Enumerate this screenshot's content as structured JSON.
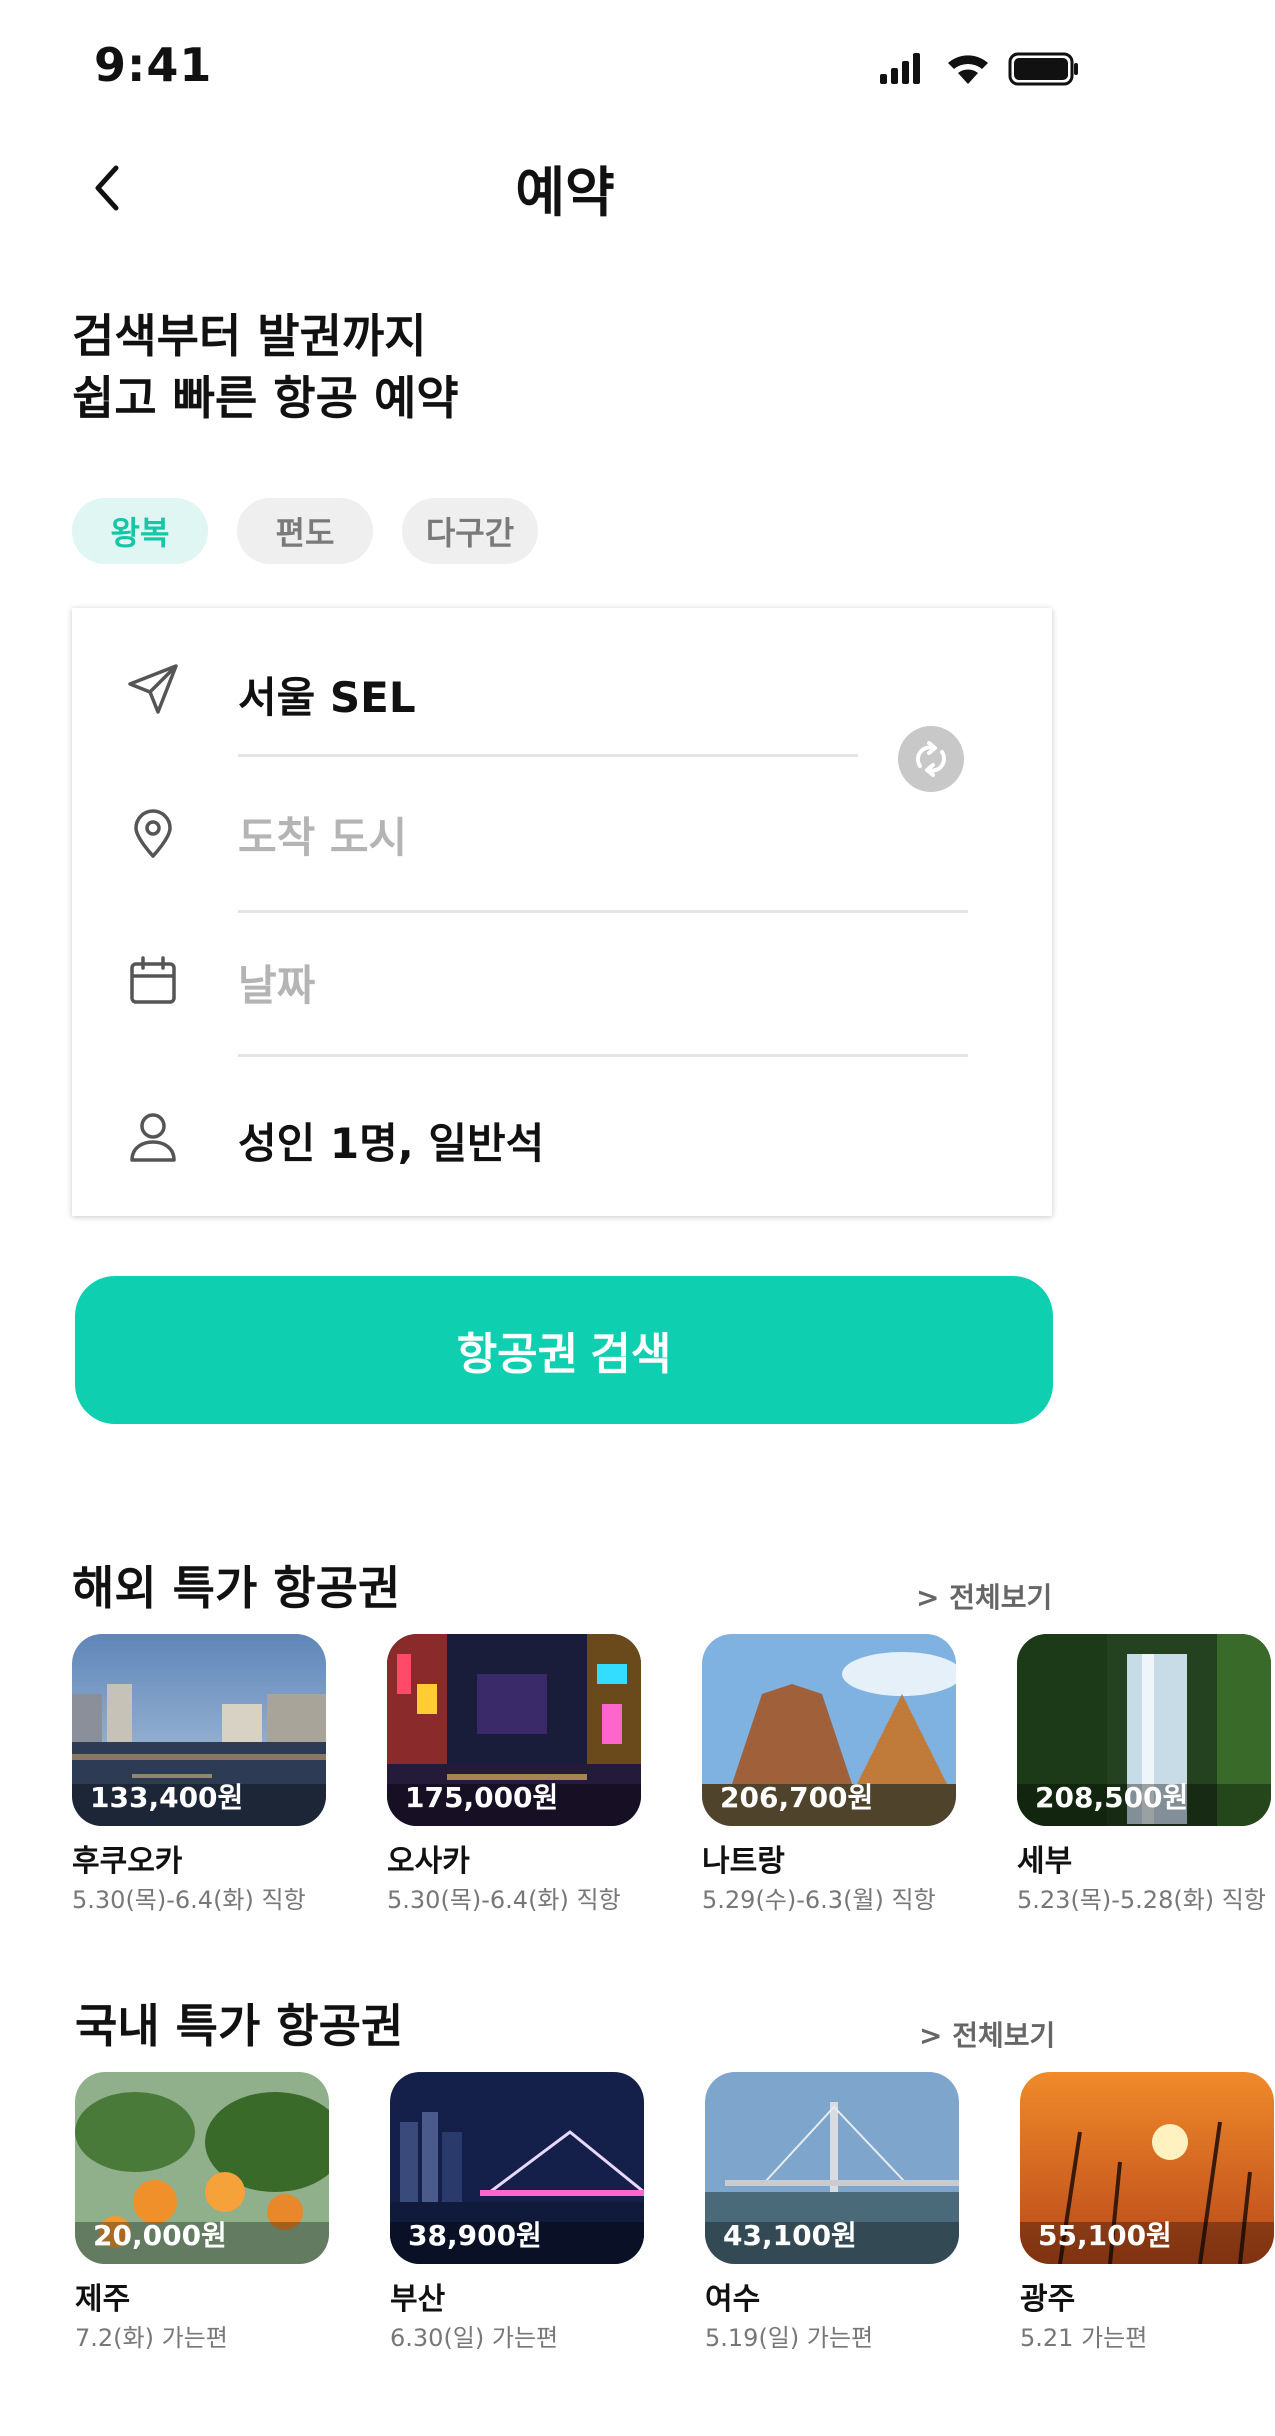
{
  "status_bar": {
    "time": "9:41"
  },
  "header": {
    "title": "예약"
  },
  "headline": {
    "line1": "검색부터 발권까지",
    "line2": "쉽고 빠른 항공 예약"
  },
  "trip_types": [
    {
      "label": "왕복",
      "active": true
    },
    {
      "label": "편도",
      "active": false
    },
    {
      "label": "다구간",
      "active": false
    }
  ],
  "form": {
    "departure": "서울 SEL",
    "arrival_placeholder": "도착 도시",
    "date_placeholder": "날짜",
    "passengers": "성인 1명, 일반석"
  },
  "search_button": "항공권 검색",
  "overseas": {
    "title": "해외 특가 항공권",
    "see_all": "> 전체보기",
    "items": [
      {
        "price": "133,400원",
        "city": "후쿠오카",
        "date": "5.30(목)-6.4(화) 직항"
      },
      {
        "price": "175,000원",
        "city": "오사카",
        "date": "5.30(목)-6.4(화) 직항"
      },
      {
        "price": "206,700원",
        "city": "나트랑",
        "date": "5.29(수)-6.3(월) 직항"
      },
      {
        "price": "208,500원",
        "city": "세부",
        "date": "5.23(목)-5.28(화) 직항"
      }
    ]
  },
  "domestic": {
    "title": "국내 특가 항공권",
    "see_all": "> 전체보기",
    "items": [
      {
        "price": "20,000원",
        "city": "제주",
        "date": "7.2(화) 가는편"
      },
      {
        "price": "38,900원",
        "city": "부산",
        "date": "6.30(일) 가는편"
      },
      {
        "price": "43,100원",
        "city": "여수",
        "date": "5.19(일) 가는편"
      },
      {
        "price": "55,100원",
        "city": "광주",
        "date": "5.21 가는편"
      }
    ]
  },
  "colors": {
    "accent": "#0ecfb0",
    "chip_active_bg": "#dff6f2",
    "chip_active_text": "#16c6a6"
  },
  "icons": [
    "back-icon",
    "send-icon",
    "location-pin-icon",
    "calendar-icon",
    "person-icon",
    "swap-icon"
  ]
}
